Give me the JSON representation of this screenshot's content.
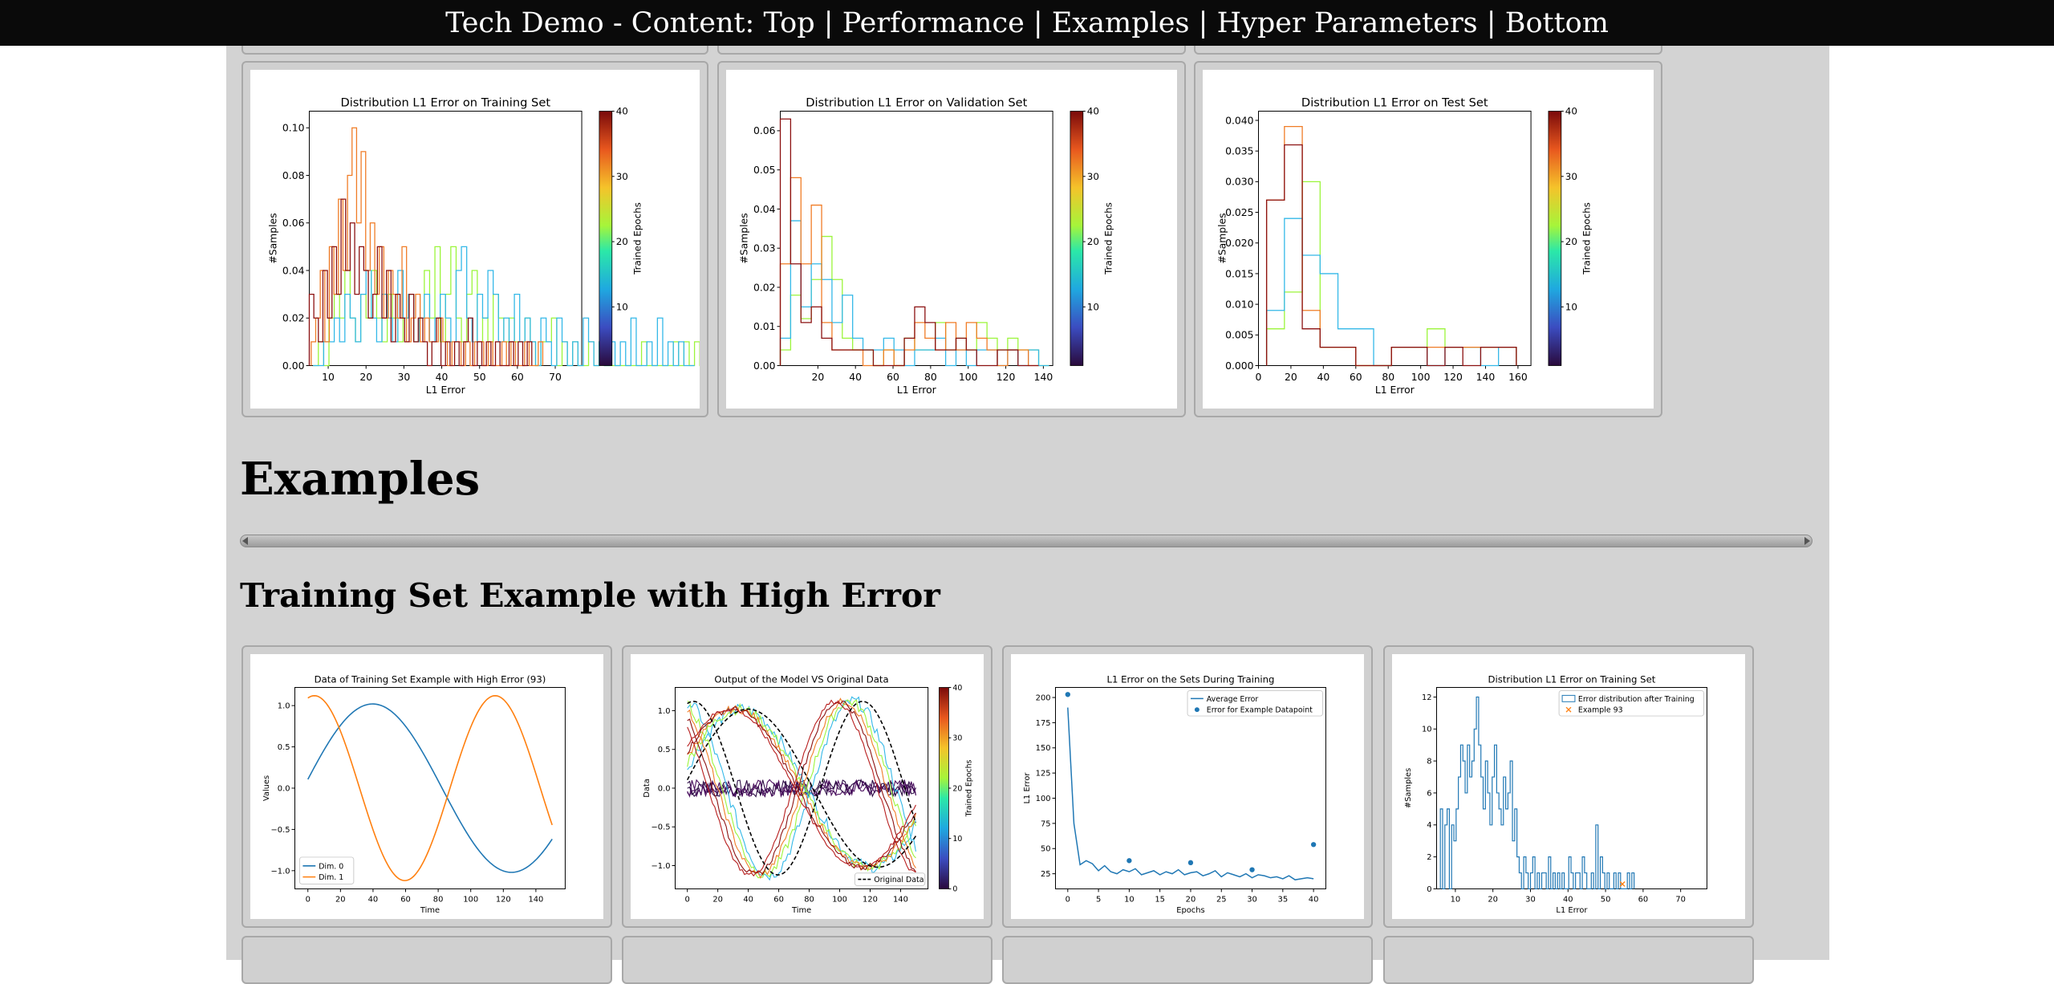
{
  "nav": {
    "title": "Tech Demo - Content:",
    "links": [
      "Top",
      "Performance",
      "Examples",
      "Hyper Parameters",
      "Bottom"
    ],
    "separator": "|"
  },
  "sections": {
    "examples_heading": "Examples",
    "training_example_heading": "Training Set Example with High Error"
  },
  "colors": {
    "page_background": "#d3d3d3",
    "topbar": "#0a0a0a",
    "frame_border": "#a8a8a8"
  },
  "colorbar": {
    "label": "Trained Epochs",
    "ticks": [
      "10",
      "20",
      "30",
      "40"
    ],
    "ticks_with_zero": [
      "0",
      "10",
      "20",
      "30",
      "40"
    ]
  },
  "chart_data": [
    {
      "type": "histogram",
      "title": "Distribution L1 Error on Training Set",
      "xlabel": "L1 Error",
      "ylabel": "#Samples",
      "xlim": [
        5,
        77
      ],
      "ylim": [
        0,
        0.107
      ],
      "xticks": [
        10,
        20,
        30,
        40,
        50,
        60,
        70
      ],
      "yticks": [
        0.0,
        0.02,
        0.04,
        0.06,
        0.08,
        0.1
      ],
      "ytick_labels": [
        "0.00",
        "0.02",
        "0.04",
        "0.06",
        "0.08",
        "0.10"
      ],
      "colorbar": "Trained Epochs",
      "series": [
        {
          "color": "#9bf53a",
          "x0": 6,
          "bin": 1.4,
          "values": [
            0,
            0.01,
            0,
            0.02,
            0.03,
            0.02,
            0.04,
            0.02,
            0.01,
            0.03,
            0.02,
            0.04,
            0.02,
            0.01,
            0.03,
            0.02,
            0.01,
            0.02,
            0.03,
            0.01,
            0.02,
            0.04,
            0.02,
            0.05,
            0.01,
            0.03,
            0.05,
            0.02,
            0.01,
            0.03,
            0.04,
            0.01,
            0.02,
            0.01,
            0.03,
            0.02,
            0.01,
            0.02,
            0.01,
            0.01,
            0.02,
            0.01,
            0,
            0.01,
            0.01,
            0.02,
            0,
            0.01,
            0,
            0.01,
            0,
            0,
            0.01,
            0,
            0.01,
            0,
            0,
            0,
            0,
            0,
            0,
            0,
            0.01,
            0,
            0,
            0,
            0,
            0,
            0.01,
            0,
            0.01,
            0,
            0.01,
            0,
            0,
            0,
            0,
            0,
            0.01,
            0
          ]
        },
        {
          "color": "#33b8e8",
          "x0": 6,
          "bin": 1.4,
          "values": [
            0,
            0,
            0.01,
            0.01,
            0.02,
            0.01,
            0.03,
            0.02,
            0.01,
            0.03,
            0.04,
            0.02,
            0.01,
            0.03,
            0.02,
            0.01,
            0.04,
            0.02,
            0.03,
            0.01,
            0.02,
            0.03,
            0.01,
            0.02,
            0.03,
            0.02,
            0.01,
            0.04,
            0.05,
            0.02,
            0.01,
            0.03,
            0.02,
            0.04,
            0.03,
            0.01,
            0.02,
            0.01,
            0.03,
            0.01,
            0.02,
            0.01,
            0,
            0.02,
            0.01,
            0,
            0.02,
            0.01,
            0,
            0.01,
            0,
            0.02,
            0.01,
            0,
            0.01,
            0,
            0.01,
            0,
            0.01,
            0,
            0.02,
            0,
            0,
            0.01,
            0,
            0.02,
            0,
            0.01,
            0,
            0.01,
            0,
            0
          ]
        },
        {
          "color": "#f07c26",
          "x0": 5.5,
          "bin": 1.2,
          "values": [
            0.01,
            0.02,
            0.04,
            0.01,
            0.05,
            0.03,
            0.07,
            0.04,
            0.08,
            0.1,
            0.06,
            0.09,
            0.04,
            0.06,
            0.03,
            0.05,
            0.02,
            0.04,
            0.03,
            0.02,
            0.05,
            0.01,
            0.02,
            0.03,
            0.01,
            0.02,
            0.01,
            0.01,
            0.02,
            0.01,
            0,
            0.01,
            0.01,
            0,
            0.01,
            0,
            0.01,
            0.01,
            0,
            0.01,
            0,
            0,
            0.01,
            0,
            0.01,
            0,
            0,
            0.01,
            0,
            0,
            0.01
          ]
        },
        {
          "color": "#8b1010",
          "x0": 5,
          "bin": 1.2,
          "values": [
            0.03,
            0.02,
            0.01,
            0.04,
            0.02,
            0.05,
            0.03,
            0.07,
            0.04,
            0.06,
            0.03,
            0.05,
            0.04,
            0.02,
            0.03,
            0.05,
            0.02,
            0.04,
            0.01,
            0.03,
            0.02,
            0.01,
            0.03,
            0.01,
            0.02,
            0.01,
            0,
            0.01,
            0.02,
            0,
            0.01,
            0,
            0.01,
            0,
            0.01,
            0.02,
            0,
            0.01,
            0,
            0.01,
            0,
            0.01,
            0,
            0,
            0.01,
            0,
            0.01,
            0,
            0.01
          ]
        }
      ]
    },
    {
      "type": "histogram",
      "title": "Distribution L1 Error on Validation Set",
      "xlabel": "L1 Error",
      "ylabel": "#Samples",
      "xlim": [
        0,
        145
      ],
      "ylim": [
        0,
        0.065
      ],
      "xticks": [
        20,
        40,
        60,
        80,
        100,
        120,
        140
      ],
      "yticks": [
        0.0,
        0.01,
        0.02,
        0.03,
        0.04,
        0.05,
        0.06
      ],
      "ytick_labels": [
        "0.00",
        "0.01",
        "0.02",
        "0.03",
        "0.04",
        "0.05",
        "0.06"
      ],
      "colorbar": "Trained Epochs",
      "series": [
        {
          "color": "#9bf53a",
          "x0": 0,
          "bin": 5.5,
          "values": [
            0.004,
            0.018,
            0.012,
            0.022,
            0.033,
            0.022,
            0.007,
            0.004,
            0.004,
            0,
            0.004,
            0,
            0.007,
            0.004,
            0.004,
            0.011,
            0.004,
            0.007,
            0.004,
            0.011,
            0.007,
            0.004,
            0.007,
            0.004,
            0.004,
            0
          ]
        },
        {
          "color": "#33b8e8",
          "x0": 0,
          "bin": 5.5,
          "values": [
            0.007,
            0.037,
            0.015,
            0.026,
            0.022,
            0.011,
            0.018,
            0.007,
            0.004,
            0.004,
            0.007,
            0.004,
            0,
            0.004,
            0.004,
            0.007,
            0,
            0.004,
            0,
            0.004,
            0.004,
            0,
            0.004,
            0,
            0.004,
            0
          ]
        },
        {
          "color": "#f07c26",
          "x0": 0,
          "bin": 5.5,
          "values": [
            0.026,
            0.048,
            0.026,
            0.041,
            0.011,
            0.004,
            0.004,
            0.004,
            0,
            0,
            0.004,
            0,
            0.004,
            0.011,
            0.007,
            0.004,
            0.011,
            0.004,
            0.011,
            0.007,
            0.004,
            0,
            0.004,
            0.004,
            0
          ]
        },
        {
          "color": "#8b1010",
          "x0": 0,
          "bin": 5.5,
          "values": [
            0.063,
            0.026,
            0.011,
            0.015,
            0.007,
            0.004,
            0.004,
            0.004,
            0.004,
            0,
            0,
            0,
            0.007,
            0.015,
            0.011,
            0.004,
            0.004,
            0.007,
            0.004,
            0,
            0,
            0.004,
            0.004,
            0,
            0
          ]
        }
      ]
    },
    {
      "type": "histogram",
      "title": "Distribution L1 Error on Test Set",
      "xlabel": "L1 Error",
      "ylabel": "#Samples",
      "xlim": [
        0,
        168
      ],
      "ylim": [
        0,
        0.0415
      ],
      "xticks": [
        0,
        20,
        40,
        60,
        80,
        100,
        120,
        140,
        160
      ],
      "yticks": [
        0.0,
        0.005,
        0.01,
        0.015,
        0.02,
        0.025,
        0.03,
        0.035,
        0.04
      ],
      "ytick_labels": [
        "0.000",
        "0.005",
        "0.010",
        "0.015",
        "0.020",
        "0.025",
        "0.030",
        "0.035",
        "0.040"
      ],
      "colorbar": "Trained Epochs",
      "series": [
        {
          "color": "#9bf53a",
          "x0": 5,
          "bin": 11,
          "values": [
            0.006,
            0.012,
            0.03,
            0.003,
            0.003,
            0,
            0,
            0.003,
            0.003,
            0.006,
            0.003,
            0.003,
            0.003,
            0.003
          ]
        },
        {
          "color": "#33b8e8",
          "x0": 5,
          "bin": 11,
          "values": [
            0.009,
            0.024,
            0.018,
            0.015,
            0.006,
            0.006,
            0,
            0.003,
            0.003,
            0,
            0.003,
            0.003,
            0,
            0.003
          ]
        },
        {
          "color": "#f07c26",
          "x0": 5,
          "bin": 11,
          "values": [
            0.027,
            0.039,
            0.009,
            0.003,
            0.003,
            0,
            0,
            0.003,
            0.003,
            0.003,
            0.003,
            0.003,
            0.003,
            0.003
          ]
        },
        {
          "color": "#8b1010",
          "x0": 5,
          "bin": 11,
          "values": [
            0.027,
            0.036,
            0.006,
            0.003,
            0.003,
            0,
            0,
            0.003,
            0.003,
            0,
            0.003,
            0,
            0.003,
            0.003
          ]
        }
      ]
    },
    {
      "type": "line",
      "title": "Data of Training Set Example with High Error (93)",
      "xlabel": "Time",
      "ylabel": "Values",
      "xlim": [
        -8,
        158
      ],
      "ylim": [
        -1.22,
        1.22
      ],
      "xticks": [
        0,
        20,
        40,
        60,
        80,
        100,
        120,
        140
      ],
      "yticks": [
        -1.0,
        -0.5,
        0.0,
        0.5,
        1.0
      ],
      "ytick_labels": [
        "−1.0",
        "−0.5",
        "0.0",
        "0.5",
        "1.0"
      ],
      "legend": {
        "placement": "lower-left",
        "entries": [
          "Dim. 0",
          "Dim. 1"
        ]
      },
      "series": [
        {
          "name": "Dim. 0",
          "color": "#1f77b4",
          "amp": 1.02,
          "period": 170,
          "phase_shift": 63,
          "start": 0.3
        },
        {
          "name": "Dim. 1",
          "color": "#ff7f0e",
          "amp": 1.12,
          "period": 111,
          "phase_shift": 4,
          "start": 1.0
        }
      ]
    },
    {
      "type": "line",
      "title": "Output of the Model VS Original Data",
      "xlabel": "Time",
      "ylabel": "Data",
      "xlim": [
        -8,
        158
      ],
      "ylim": [
        -1.3,
        1.3
      ],
      "xticks": [
        0,
        20,
        40,
        60,
        80,
        100,
        120,
        140
      ],
      "yticks": [
        -1.0,
        -0.5,
        0.0,
        0.5,
        1.0
      ],
      "ytick_labels": [
        "−1.0",
        "−0.5",
        "0.0",
        "0.5",
        "1.0"
      ],
      "legend": {
        "placement": "lower-right",
        "entries": [
          "Original Data"
        ]
      },
      "colorbar": "Trained Epochs",
      "series": [
        {
          "color": "#2d0b45",
          "amp": 0.05,
          "period": 6,
          "phase_shift": 0,
          "noise": 0.08
        },
        {
          "color": "#4a0f5e",
          "amp": 0.04,
          "period": 9,
          "phase_shift": 2,
          "noise": 0.07
        },
        {
          "color": "#33b8e8",
          "amp": 1.05,
          "period": 111,
          "phase_shift": 4,
          "noise": 0.08
        },
        {
          "color": "#9bf53a",
          "amp": 1.08,
          "period": 111,
          "phase_shift": 10,
          "noise": 0.07
        },
        {
          "color": "#f07c26",
          "amp": 1.1,
          "period": 111,
          "phase_shift": 2,
          "noise": 0.05
        },
        {
          "color": "#8b1010",
          "amp": 1.1,
          "period": 170,
          "phase_shift": 63,
          "noise": 0.04
        },
        {
          "color": "#b71c1c",
          "amp": 1.1,
          "period": 111,
          "phase_shift": 4,
          "noise": 0.03
        }
      ]
    },
    {
      "type": "line",
      "title": "L1 Error on the Sets During Training",
      "xlabel": "Epochs",
      "ylabel": "L1 Error",
      "xlim": [
        -2,
        42
      ],
      "ylim": [
        10,
        210
      ],
      "xticks": [
        0,
        5,
        10,
        15,
        20,
        25,
        30,
        35,
        40
      ],
      "yticks": [
        25,
        50,
        75,
        100,
        125,
        150,
        175,
        200
      ],
      "legend": {
        "placement": "top-right",
        "entries": [
          "Average Error",
          "Error for Example Datapoint"
        ]
      },
      "series": [
        {
          "name": "Average Error",
          "color": "#1f77b4",
          "x": [
            0,
            1,
            2,
            3,
            4,
            5,
            6,
            7,
            8,
            9,
            10,
            11,
            12,
            13,
            14,
            15,
            16,
            17,
            18,
            19,
            20,
            21,
            22,
            23,
            24,
            25,
            26,
            27,
            28,
            29,
            30,
            31,
            32,
            33,
            34,
            35,
            36,
            37,
            38,
            39,
            40
          ],
          "values": [
            190,
            75,
            34,
            38,
            35,
            28,
            33,
            27,
            25,
            29,
            27,
            30,
            24,
            26,
            28,
            24,
            27,
            25,
            29,
            24,
            26,
            27,
            23,
            25,
            28,
            22,
            26,
            24,
            22,
            25,
            21,
            24,
            23,
            21,
            22,
            20,
            23,
            19,
            20,
            21,
            20
          ]
        },
        {
          "name": "Error for Example Datapoint",
          "color": "#1f77b4",
          "x": [
            0,
            10,
            20,
            30,
            40
          ],
          "values": [
            203,
            38,
            36,
            29,
            54
          ]
        }
      ]
    },
    {
      "type": "histogram",
      "title": "Distribution L1 Error on Training Set",
      "xlabel": "L1 Error",
      "ylabel": "#Samples",
      "xlim": [
        5,
        77
      ],
      "ylim": [
        0,
        12.6
      ],
      "xticks": [
        10,
        20,
        30,
        40,
        50,
        60,
        70
      ],
      "yticks": [
        0,
        2,
        4,
        6,
        8,
        10,
        12
      ],
      "legend": {
        "placement": "top-right",
        "entries": [
          "Error distribution after Training",
          "Example 93"
        ]
      },
      "series": [
        {
          "name": "Error distribution after Training",
          "color": "#1f77b4",
          "x0": 6,
          "bin": 0.6,
          "values": [
            5,
            0,
            4,
            5,
            0,
            4,
            3,
            5,
            7,
            9,
            8,
            6,
            9,
            7,
            8,
            10,
            12,
            9,
            7,
            5,
            8,
            6,
            4,
            7,
            9,
            6,
            5,
            4,
            7,
            5,
            6,
            8,
            3,
            5,
            2,
            1,
            0,
            2,
            1,
            0,
            1,
            2,
            0,
            1,
            0,
            1,
            1,
            0,
            2,
            0,
            1,
            0,
            1,
            0,
            1,
            0,
            0,
            2,
            1,
            0,
            1,
            1,
            0,
            2,
            1,
            0,
            0,
            1,
            0,
            4,
            0,
            2,
            1,
            0,
            1,
            0,
            0,
            1,
            0,
            1,
            0,
            0,
            0,
            1,
            0,
            1
          ]
        },
        {
          "name": "Example 93",
          "color": "#ff7f0e",
          "x": [
            54.5
          ],
          "values": [
            0.3
          ]
        }
      ]
    }
  ]
}
